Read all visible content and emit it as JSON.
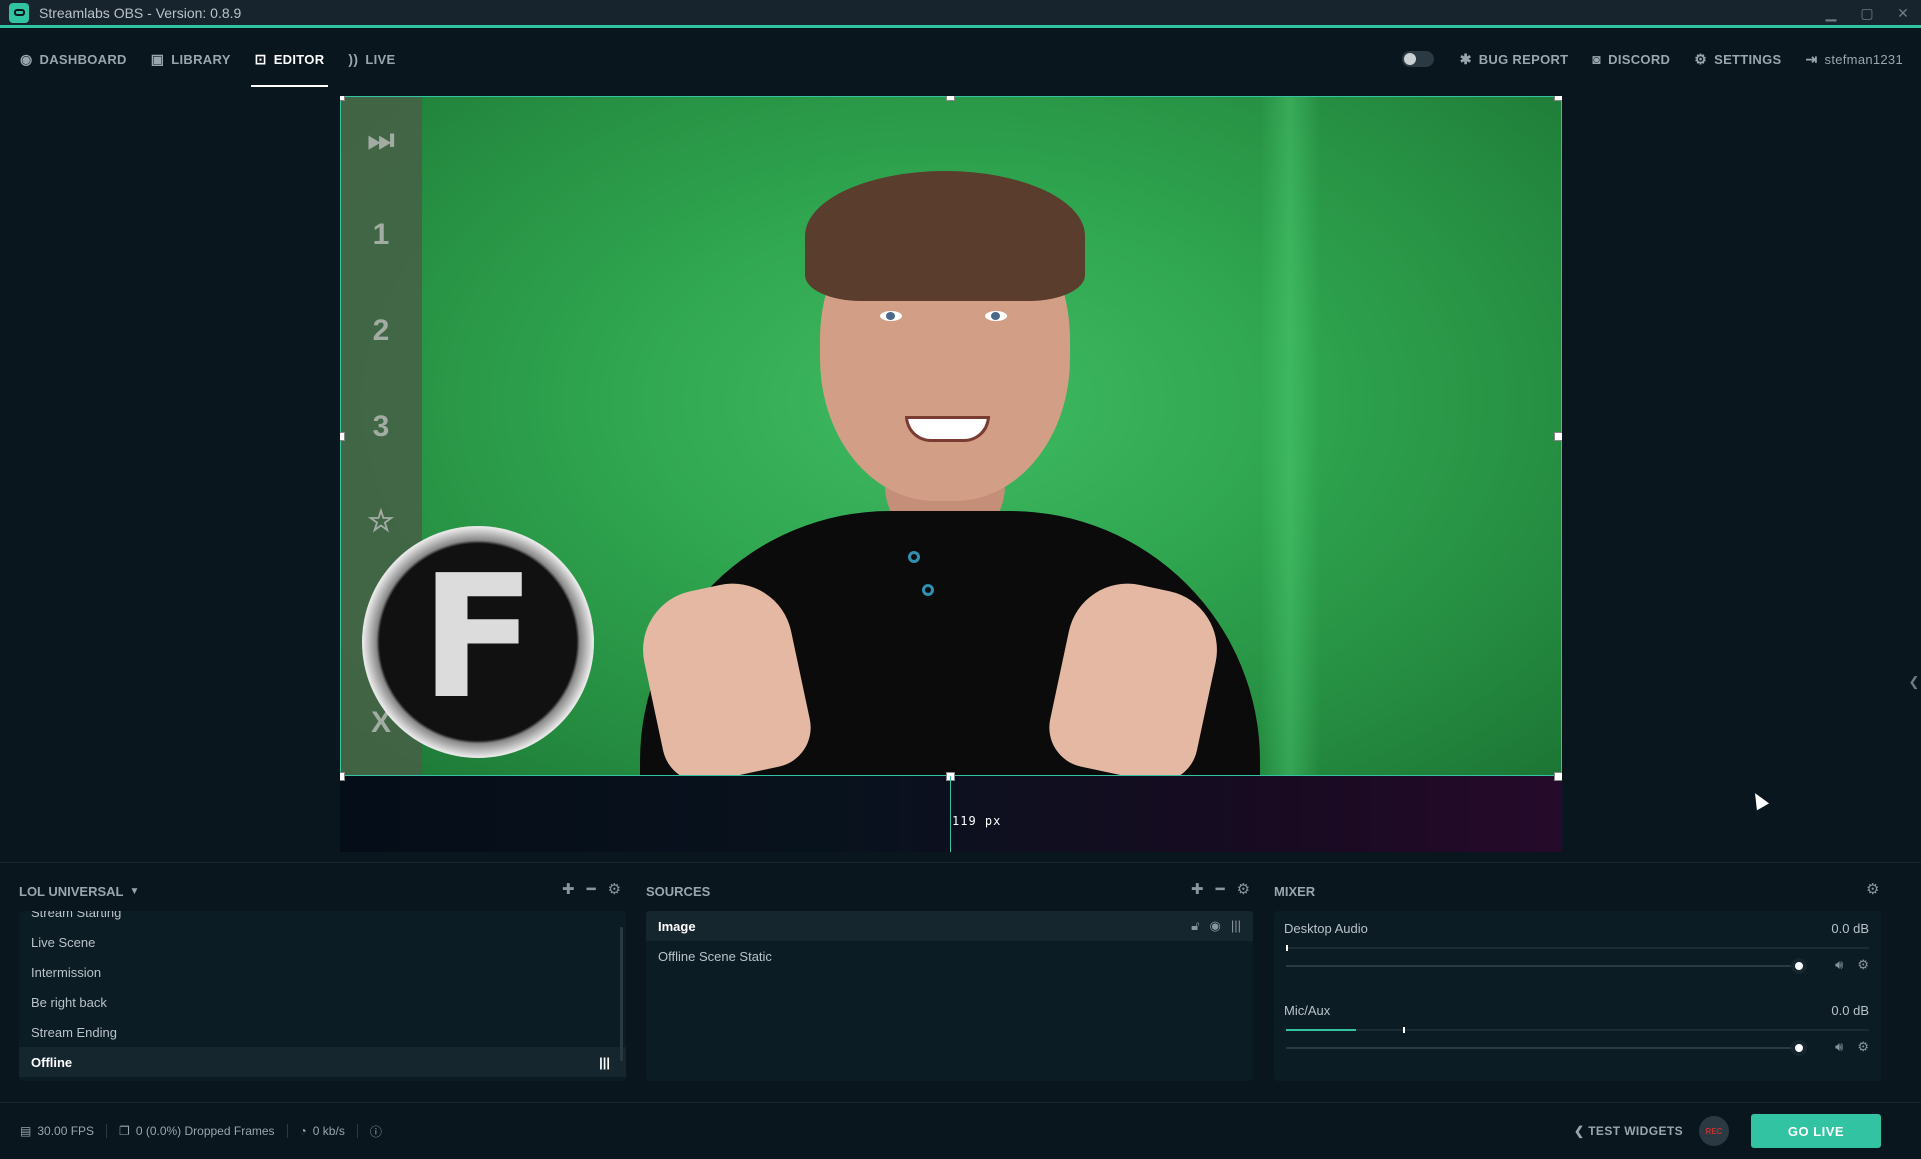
{
  "app": {
    "title": "Streamlabs OBS - Version: 0.8.9"
  },
  "nav": {
    "left": [
      {
        "label": "DASHBOARD",
        "icon": "dashboard-icon"
      },
      {
        "label": "LIBRARY",
        "icon": "library-icon"
      },
      {
        "label": "EDITOR",
        "icon": "editor-icon",
        "active": true
      },
      {
        "label": "LIVE",
        "icon": "live-icon"
      }
    ],
    "right": [
      {
        "label": "BUG REPORT",
        "icon": "bug-icon"
      },
      {
        "label": "DISCORD",
        "icon": "discord-icon"
      },
      {
        "label": "SETTINGS",
        "icon": "gear-icon"
      },
      {
        "label": "stefman1231",
        "icon": "logout-icon"
      }
    ]
  },
  "preview": {
    "overlay_strip": [
      "⏭",
      "1",
      "2",
      "3",
      "☆",
      "X"
    ],
    "logo_letter": "F",
    "guide_label": "119 px"
  },
  "scenes": {
    "collection": "LOL UNIVERSAL",
    "items": [
      "Stream Starting",
      "Live Scene",
      "Intermission",
      "Be right back",
      "Stream Ending",
      "Offline"
    ],
    "selected": "Offline"
  },
  "sources": {
    "header": "SOURCES",
    "items": [
      "Image",
      "Offline Scene Static"
    ],
    "selected": "Image"
  },
  "mixer": {
    "header": "MIXER",
    "channels": [
      {
        "name": "Desktop Audio",
        "db": "0.0 dB",
        "level": 0.0,
        "volume": 1.0
      },
      {
        "name": "Mic/Aux",
        "db": "0.0 dB",
        "level": 0.12,
        "peak": 0.2,
        "volume": 1.0
      }
    ]
  },
  "status": {
    "fps": "30.00 FPS",
    "dropped": "0 (0.0%) Dropped Frames",
    "bitrate": "0 kb/s",
    "test_widgets": "TEST WIDGETS",
    "rec": "REC",
    "go_live": "GO LIVE"
  },
  "colors": {
    "accent": "#31c3a2",
    "background": "#09161d",
    "panel": "#0c1c25"
  }
}
